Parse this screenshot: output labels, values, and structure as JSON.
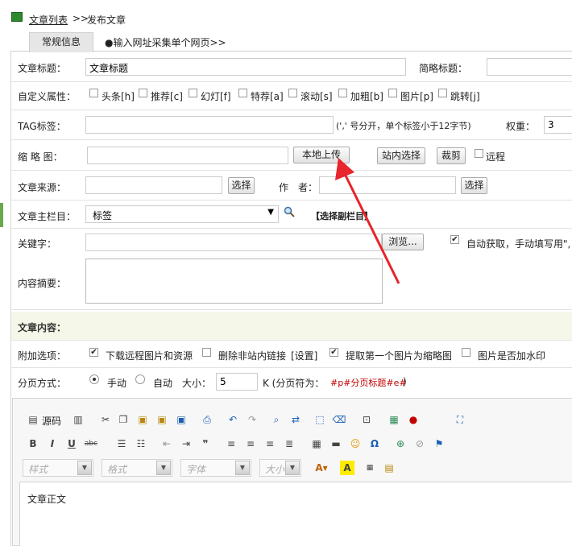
{
  "breadcrumb": {
    "list_link": "文章列表",
    "separator": ">>",
    "current": "发布文章"
  },
  "tabs": [
    {
      "label": "常规信息"
    },
    {
      "label": "●输入网址采集单个网页>>"
    }
  ],
  "form": {
    "title_label": "文章标题：",
    "title_value": "文章标题",
    "short_title_label": "简略标题：",
    "custom_attr_label": "自定义属性：",
    "attrs": [
      "头条[h]",
      "推荐[c]",
      "幻灯[f]",
      "特荐[a]",
      "滚动[s]",
      "加粗[b]",
      "图片[p]",
      "跳转[j]"
    ],
    "tag_label": "TAG标签：",
    "tag_hint": "(',' 号分开，单个标签小于12字节)",
    "weight_label": "权重：",
    "weight_value": "3",
    "thumb_label": "缩 略 图：",
    "upload_button": "本地上传",
    "site_select_button": "站内选择",
    "crop_button": "裁剪",
    "remote_label": "远程",
    "source_label": "文章来源：",
    "select_button": "选择",
    "author_label": "作　者：",
    "author_select_button": "选择",
    "column_label": "文章主栏目：",
    "column_value": "标签",
    "sub_column_link": "【选择副栏目】",
    "keywords_label": "关键字：",
    "browse_button": "浏览...",
    "auto_fetch_label": "自动获取，手动填写用\",",
    "summary_label": "内容摘要：",
    "content_section": "文章内容：",
    "extra_label": "附加选项：",
    "extra_options": [
      {
        "label": "下载远程图片和资源",
        "checked": true
      },
      {
        "label": "删除非站内链接",
        "checked": false
      },
      {
        "label": "[设置]",
        "checked": null
      },
      {
        "label": "提取第一个图片为缩略图",
        "checked": true
      },
      {
        "label": "图片是否加水印",
        "checked": false
      }
    ],
    "paging_label": "分页方式：",
    "paging_manual": "手动",
    "paging_auto": "自动",
    "size_label": "大小：",
    "size_value": "5",
    "size_unit": "K (分页符为：",
    "page_tag": "#p#分页标题#e#",
    "size_close": ")"
  },
  "editor": {
    "source_label": "源码",
    "style_dd": "样式",
    "format_dd": "格式",
    "font_dd": "字体",
    "size_dd": "大小",
    "body_text": "文章正文"
  },
  "colors": {
    "section_bg": "#f5f8e9",
    "accent_red": "#c00000",
    "arrow_red": "#e8242c",
    "tab_bg": "#e6e6e6"
  }
}
